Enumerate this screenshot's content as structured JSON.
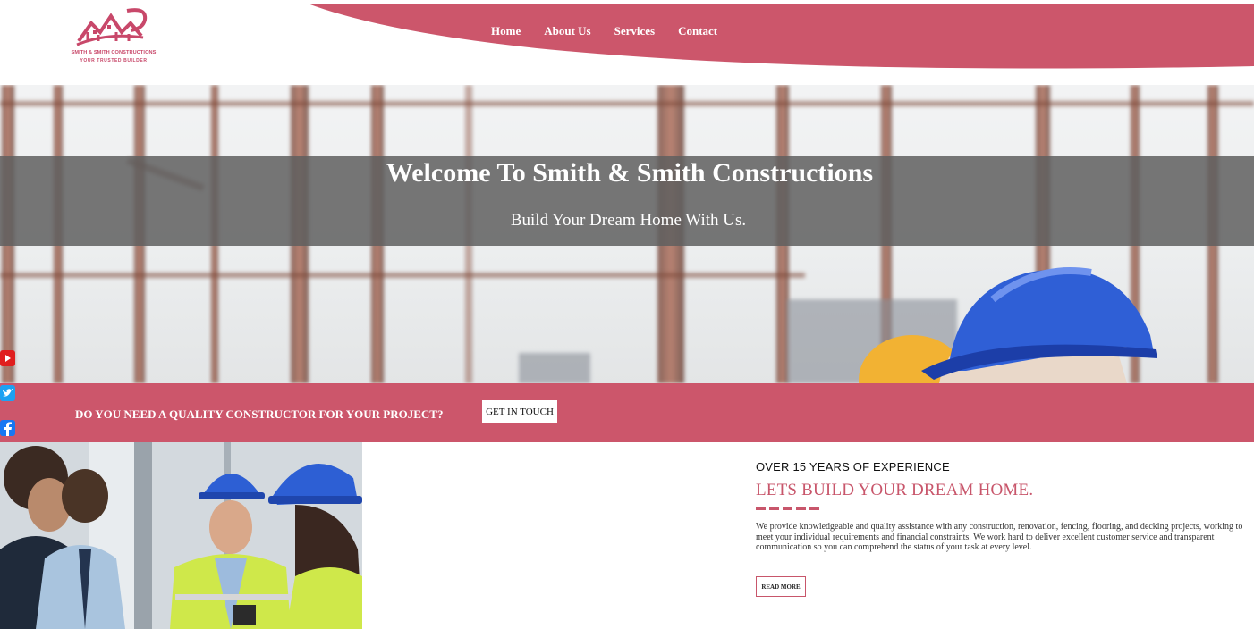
{
  "brand": {
    "name": "SMITH & SMITH CONSTRUCTIONS",
    "tagline": "YOUR TRUSTED BUILDER",
    "accent_color": "#cc566b"
  },
  "nav": {
    "items": [
      "Home",
      "About Us",
      "Services",
      "Contact"
    ]
  },
  "hero": {
    "title": "Welcome To Smith & Smith Constructions",
    "subtitle": "Build Your Dream Home With Us."
  },
  "cta": {
    "question": "DO YOU NEED A QUALITY CONSTRUCTOR FOR YOUR PROJECT?",
    "button": "GET IN TOUCH"
  },
  "social": [
    {
      "icon": "youtube-icon",
      "color": "#e01e1e"
    },
    {
      "icon": "twitter-icon",
      "color": "#1da1f2"
    },
    {
      "icon": "facebook-icon",
      "color": "#1877f2"
    },
    {
      "icon": "instagram-icon",
      "color": "#d6249f"
    }
  ],
  "about": {
    "kicker": "OVER 15 YEARS OF EXPERIENCE",
    "headline": "LETS BUILD YOUR DREAM HOME.",
    "description": "We provide knowledgeable and quality assistance with any construction, renovation, fencing, flooring, and decking projects, working to meet your individual requirements and financial constraints. We work hard to deliver excellent customer service and transparent communication so you can comprehend the status of your task at every level.",
    "button": "READ MORE"
  }
}
